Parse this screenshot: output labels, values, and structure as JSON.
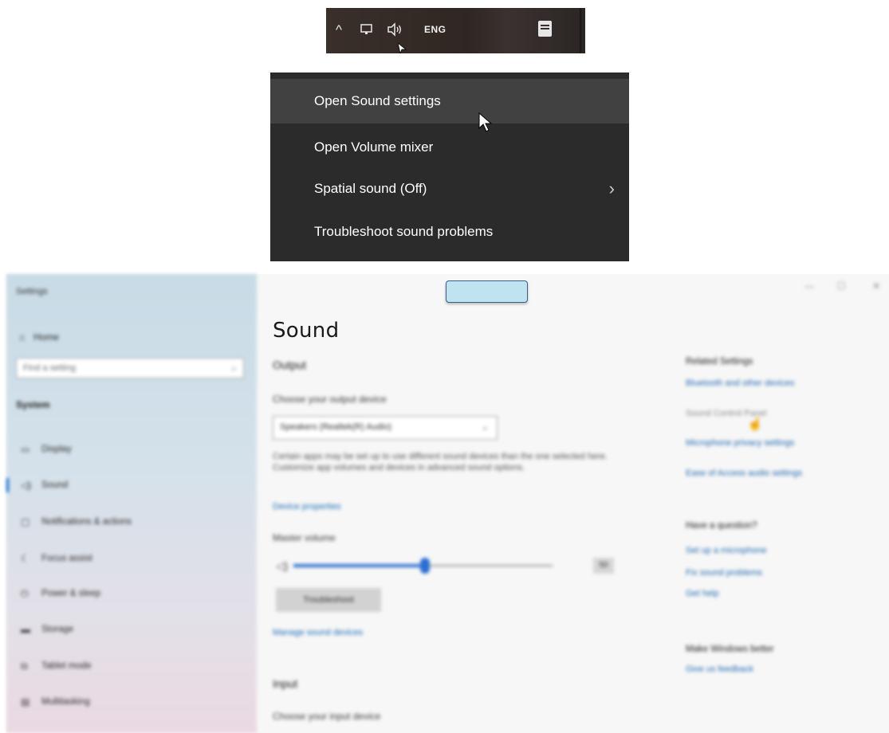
{
  "taskbar": {
    "icons": [
      "chevron-up-icon",
      "network-icon",
      "volume-icon",
      "notification-icon"
    ],
    "language": "ENG"
  },
  "context_menu": {
    "items": [
      {
        "label": "Open Sound settings",
        "highlighted": true
      },
      {
        "label": "Open Volume mixer"
      },
      {
        "label": "Spatial sound (Off)",
        "has_submenu": true
      },
      {
        "label": "Troubleshoot sound problems"
      }
    ]
  },
  "settings": {
    "app_title": "Settings",
    "home_label": "Home",
    "search_placeholder": "Find a setting",
    "section": "System",
    "nav_items": [
      {
        "label": "Display",
        "icon": "display-icon"
      },
      {
        "label": "Sound",
        "icon": "sound-icon",
        "active": true
      },
      {
        "label": "Notifications & actions",
        "icon": "notifications-icon"
      },
      {
        "label": "Focus assist",
        "icon": "moon-icon"
      },
      {
        "label": "Power & sleep",
        "icon": "power-icon"
      },
      {
        "label": "Storage",
        "icon": "storage-icon"
      },
      {
        "label": "Tablet mode",
        "icon": "tablet-icon"
      },
      {
        "label": "Multitasking",
        "icon": "multitasking-icon"
      }
    ],
    "page_title": "Sound",
    "output": {
      "heading": "Output",
      "device_label": "Choose your output device",
      "device_value": "Speakers (Realtek(R) Audio)",
      "description": "Certain apps may be set up to use different sound devices than the one selected here. Customize app volumes and devices in advanced sound options.",
      "properties_link": "Device properties",
      "volume_label": "Master volume",
      "volume_value": "50",
      "troubleshoot_button": "Troubleshoot",
      "manage_link": "Manage sound devices"
    },
    "input": {
      "heading": "Input",
      "device_label": "Choose your input device"
    },
    "related": {
      "heading": "Related Settings",
      "links": [
        "Bluetooth and other devices",
        "Sound Control Panel",
        "Microphone privacy settings",
        "Ease of Access audio settings"
      ]
    },
    "question": {
      "heading": "Have a question?",
      "links": [
        "Set up a microphone",
        "Fix sound problems",
        "Get help"
      ]
    },
    "better": {
      "heading": "Make Windows better",
      "links": [
        "Give us feedback"
      ]
    },
    "window_controls": [
      "—",
      "☐",
      "✕"
    ]
  }
}
